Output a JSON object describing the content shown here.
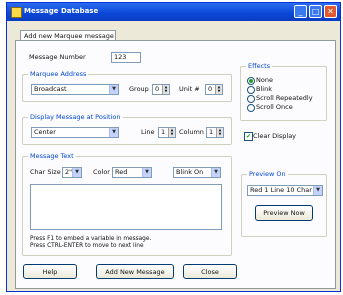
{
  "window": {
    "title": "Message Database",
    "controls": [
      "_",
      "□",
      "✕"
    ]
  },
  "tab": {
    "label": "Add new Marquee message"
  },
  "message_number": {
    "label": "Message Number",
    "value": "123"
  },
  "marquee_address": {
    "title": "Marquee Address",
    "address": "Broadcast",
    "group_label": "Group",
    "group_value": "0",
    "unit_label": "Unit #",
    "unit_value": "0"
  },
  "display_position": {
    "title": "Display Message at Position",
    "position": "Center",
    "line_label": "Line",
    "line_value": "1",
    "column_label": "Column",
    "column_value": "1"
  },
  "message_text": {
    "title": "Message Text",
    "char_size_label": "Char Size",
    "char_size_value": "2\"",
    "color_label": "Color",
    "color_value": "Red",
    "blink_value": "Blink On",
    "hint1": "Press F1 to embed a variable in message.",
    "hint2": "Press CTRL-ENTER to move to next line"
  },
  "effects": {
    "title": "Effects",
    "options": [
      "None",
      "Blink",
      "Scroll Repeatedly",
      "Scroll Once"
    ],
    "selected_index": 0
  },
  "clear_display": {
    "label": "Clear Display",
    "checked": true
  },
  "preview": {
    "title": "Preview On",
    "value": "Red 1 Line 10 Char",
    "button": "Preview Now"
  },
  "buttons": {
    "help": "Help",
    "add": "Add New Message",
    "close": "Close"
  }
}
